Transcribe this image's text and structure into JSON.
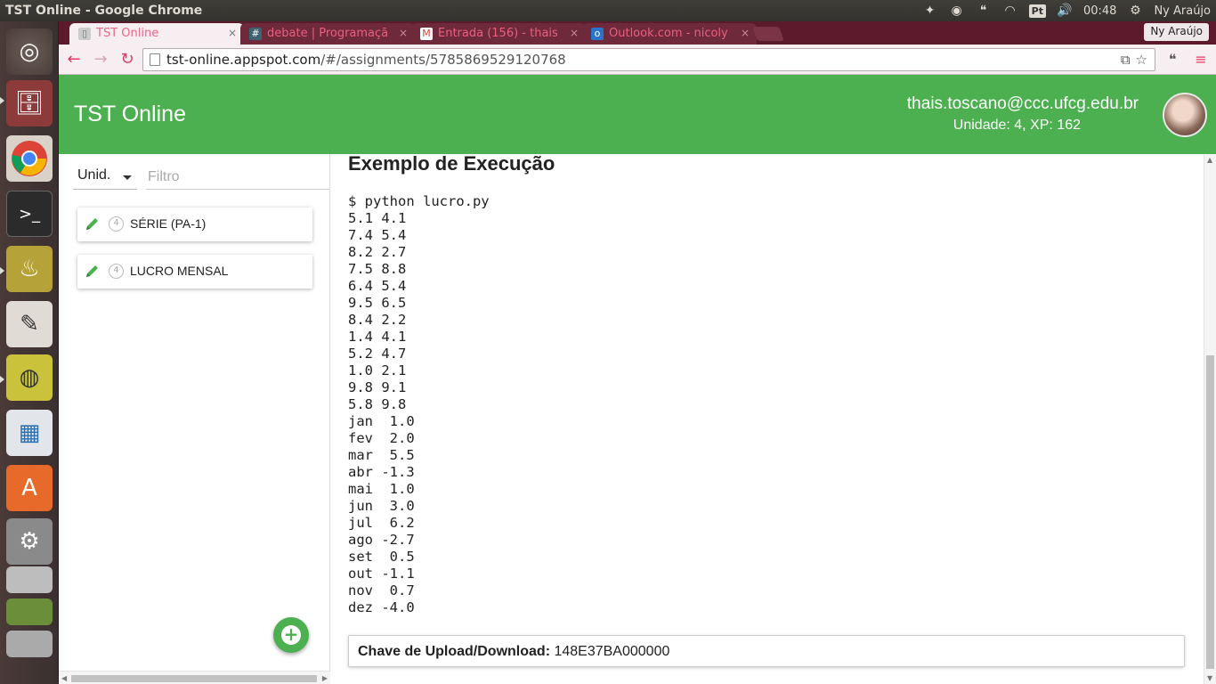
{
  "os": {
    "window_title": "TST Online - Google Chrome",
    "clock": "00:48",
    "user": "Ny Araújo",
    "keyboard_layout": "Pt"
  },
  "browser": {
    "profile": "Ny Araújo",
    "url_host": "tst-online.appspot.com",
    "url_path": "/#/assignments/5785869529120768",
    "tabs": [
      {
        "label": "TST Online",
        "icon": "page-icon",
        "active": true
      },
      {
        "label": "debate | Programaçã",
        "icon": "hash-icon",
        "active": false
      },
      {
        "label": "Entrada (156) - thais",
        "icon": "gmail-icon",
        "active": false
      },
      {
        "label": "Outlook.com - nicoly",
        "icon": "outlook-icon",
        "active": false
      }
    ],
    "close_glyph": "×"
  },
  "app": {
    "brand": "TST Online",
    "user_email": "thais.toscano@ccc.ufcg.edu.br",
    "user_stats": "Unidade: 4, XP: 162",
    "accent_color": "#4caf50"
  },
  "sidebar": {
    "unit_select": "Unid.",
    "filter_placeholder": "Filtro",
    "items": [
      {
        "unit": "4",
        "label": "SÉRIE (PA-1)"
      },
      {
        "unit": "4",
        "label": "LUCRO MENSAL"
      }
    ],
    "fab_glyph": "+"
  },
  "main": {
    "heading": "Exemplo de Execução",
    "code": "$ python lucro.py\n5.1 4.1\n7.4 5.4\n8.2 2.7\n7.5 8.8\n6.4 5.4\n9.5 6.5\n8.4 2.2\n1.4 4.1\n5.2 4.7\n1.0 2.1\n9.8 9.1\n5.8 9.8\njan  1.0\nfev  2.0\nmar  5.5\nabr -1.3\nmai  1.0\njun  3.0\njul  6.2\nago -2.7\nset  0.5\nout -1.1\nnov  0.7\ndez -4.0",
    "key_label": "Chave de Upload/Download:",
    "key_value": "148E37BA000000"
  }
}
